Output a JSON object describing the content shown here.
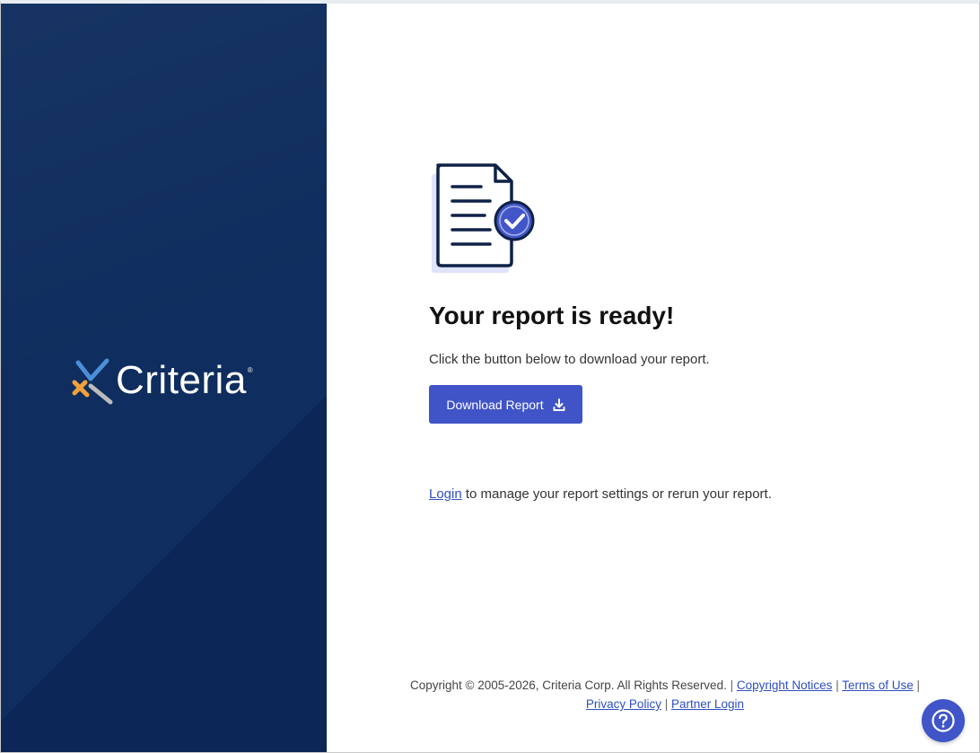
{
  "brand": {
    "name": "Criteria",
    "registered_mark": "®",
    "colors": {
      "panel": "#0f2d5e",
      "logo_blue": "#4a8fd8",
      "logo_orange": "#f2a03d",
      "logo_gray": "#bcbcbc"
    }
  },
  "main": {
    "illustration_icon": "document-check-icon",
    "title": "Your report is ready!",
    "subtitle": "Click the button below to download your report.",
    "download_button": {
      "label": "Download Report",
      "icon": "download-icon",
      "color": "#4054c7"
    },
    "login_link": "Login",
    "login_text": " to manage your report settings or rerun your report."
  },
  "footer": {
    "copyright": "Copyright © 2005-2026, Criteria Corp. All Rights Reserved.",
    "separator": "|",
    "links": {
      "copyright_notices": "Copyright Notices",
      "terms": "Terms of Use",
      "privacy": "Privacy Policy",
      "partner_login": "Partner Login"
    }
  },
  "help": {
    "icon": "question-circle-icon",
    "color": "#3f55c8"
  }
}
